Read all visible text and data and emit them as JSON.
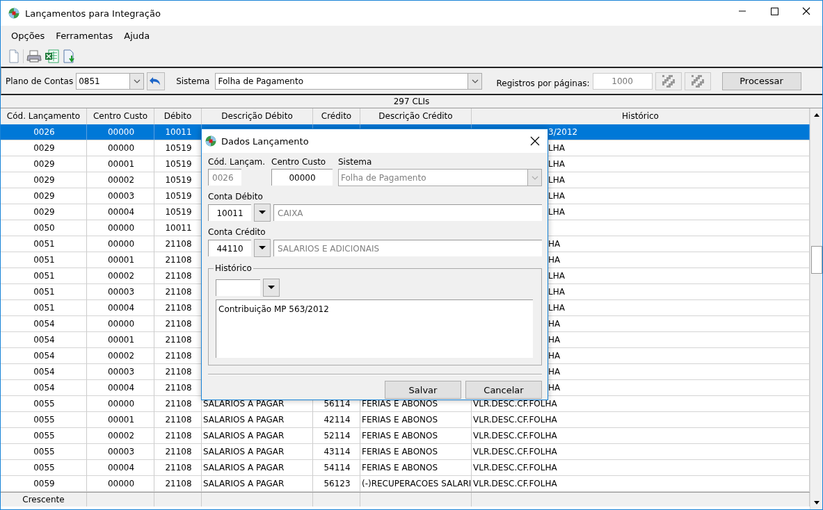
{
  "window": {
    "title": "Lançamentos para Integração"
  },
  "menu": [
    "Opções",
    "Ferramentas",
    "Ajuda"
  ],
  "filter": {
    "plano_label": "Plano de Contas",
    "plano_value": "0851",
    "sistema_label": "Sistema",
    "sistema_value": "Folha de Pagamento",
    "registros_label": "Registros por páginas:",
    "registros_value": "1000",
    "registros_disabled": true,
    "process_button": "Processar"
  },
  "count_bar": "297 CLIs",
  "table": {
    "columns": [
      "Cód. Lançamento",
      "Centro Custo",
      "Débito",
      "Descrição Débito",
      "Crédito",
      "Descrição Crédito",
      "Histórico"
    ],
    "rows": [
      {
        "cells": [
          "0026",
          "00000",
          "10011",
          null,
          null,
          null,
          "3/2012"
        ],
        "selected": true
      },
      {
        "cells": [
          "0029",
          "00000",
          "10519",
          null,
          null,
          null,
          "LHA"
        ],
        "selected": false
      },
      {
        "cells": [
          "0029",
          "00001",
          "10519",
          null,
          null,
          null,
          "LHA"
        ],
        "selected": false
      },
      {
        "cells": [
          "0029",
          "00002",
          "10519",
          null,
          null,
          null,
          "LHA"
        ],
        "selected": false
      },
      {
        "cells": [
          "0029",
          "00003",
          "10519",
          null,
          null,
          null,
          "LHA"
        ],
        "selected": false
      },
      {
        "cells": [
          "0029",
          "00004",
          "10519",
          null,
          null,
          null,
          "LHA"
        ],
        "selected": false
      },
      {
        "cells": [
          "0050",
          "00000",
          "10011",
          null,
          null,
          null,
          null
        ],
        "selected": false
      },
      {
        "cells": [
          "0051",
          "00000",
          "21108",
          null,
          null,
          null,
          "HA"
        ],
        "selected": false
      },
      {
        "cells": [
          "0051",
          "00001",
          "21108",
          null,
          null,
          null,
          "HA"
        ],
        "selected": false
      },
      {
        "cells": [
          "0051",
          "00002",
          "21108",
          null,
          null,
          null,
          "LHA"
        ],
        "selected": false
      },
      {
        "cells": [
          "0051",
          "00003",
          "21108",
          null,
          null,
          null,
          "LHA"
        ],
        "selected": false
      },
      {
        "cells": [
          "0051",
          "00004",
          "21108",
          null,
          null,
          null,
          "LHA"
        ],
        "selected": false
      },
      {
        "cells": [
          "0054",
          "00000",
          "21108",
          null,
          null,
          null,
          "HA"
        ],
        "selected": false
      },
      {
        "cells": [
          "0054",
          "00001",
          "21108",
          null,
          null,
          null,
          "HA"
        ],
        "selected": false
      },
      {
        "cells": [
          "0054",
          "00002",
          "21108",
          null,
          null,
          null,
          "HA"
        ],
        "selected": false
      },
      {
        "cells": [
          "0054",
          "00003",
          "21108",
          null,
          null,
          null,
          "HA"
        ],
        "selected": false
      },
      {
        "cells": [
          "0054",
          "00004",
          "21108",
          null,
          null,
          null,
          "HA"
        ],
        "selected": false
      },
      {
        "cells": [
          "0055",
          "00000",
          "21108",
          "SALARIOS A PAGAR",
          "56114",
          "FERIAS E ABONOS",
          "VLR.DESC.CF.FOLHA"
        ],
        "selected": false
      },
      {
        "cells": [
          "0055",
          "00001",
          "21108",
          "SALARIOS A PAGAR",
          "42114",
          "FERIAS E ABONOS",
          "VLR.DESC.CF.FOLHA"
        ],
        "selected": false
      },
      {
        "cells": [
          "0055",
          "00002",
          "21108",
          "SALARIOS A PAGAR",
          "52114",
          "FERIAS E ABONOS",
          "VLR.DESC.CF.FOLHA"
        ],
        "selected": false
      },
      {
        "cells": [
          "0055",
          "00003",
          "21108",
          "SALARIOS A PAGAR",
          "43114",
          "FERIAS E ABONOS",
          "VLR.DESC.CF.FOLHA"
        ],
        "selected": false
      },
      {
        "cells": [
          "0055",
          "00004",
          "21108",
          "SALARIOS A PAGAR",
          "54114",
          "FERIAS E ABONOS",
          "VLR.DESC.CF.FOLHA"
        ],
        "selected": false
      },
      {
        "cells": [
          "0059",
          "00000",
          "21108",
          "SALARIOS A PAGAR",
          "56123",
          "(-)RECUPERACOES SALARI",
          "VLR.DESC.CF.FOLHA"
        ],
        "selected": false
      }
    ],
    "footer": [
      "Crescente"
    ]
  },
  "dialog": {
    "title": "Dados Lançamento",
    "cod_label": "Cód. Lançam.",
    "cod_value": "0026",
    "cod_disabled": true,
    "centro_label": "Centro Custo",
    "centro_value": "00000",
    "centro_disabled": false,
    "sistema_label": "Sistema",
    "sistema_value": "Folha de Pagamento",
    "sistema_disabled": true,
    "debito_label": "Conta Débito",
    "debito_value": "10011",
    "debito_desc": "CAIXA",
    "debito_desc_disabled": true,
    "credito_label": "Conta Crédito",
    "credito_value": "44110",
    "credito_desc": "SALARIOS E ADICIONAIS",
    "credito_desc_disabled": true,
    "historico_label": "Histórico",
    "historico_text": "Contribuição MP 563/2012",
    "buttons": [
      "Salvar",
      "Cancelar"
    ]
  }
}
